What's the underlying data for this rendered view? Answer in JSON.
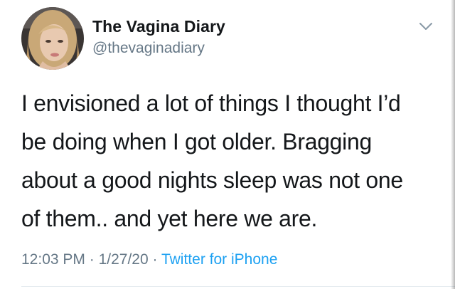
{
  "tweet": {
    "author": {
      "display_name": "The Vagina Diary",
      "handle": "@thevaginadiary",
      "avatar": "profile-photo"
    },
    "menu_icon": "chevron-down-icon",
    "text": "I envisioned a lot of things I thought I’d\nbe doing when I got older. Bragging\nabout a good nights sleep was not one\nof them.. and yet here we are.",
    "time": "12:03 PM",
    "date": "1/27/20",
    "separator": "·",
    "source": "Twitter for iPhone"
  },
  "colors": {
    "text_primary": "#14171a",
    "text_secondary": "#657786",
    "link": "#1da1f2",
    "divider": "#e6ecf0"
  }
}
